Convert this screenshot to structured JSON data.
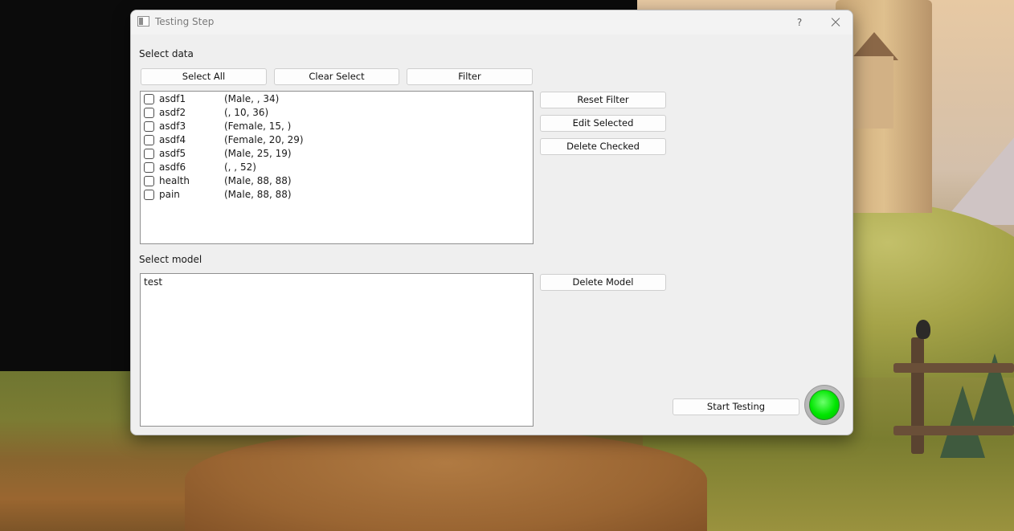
{
  "window": {
    "title": "Testing Step",
    "help_label": "?"
  },
  "data_section": {
    "label": "Select data",
    "buttons": {
      "select_all": "Select All",
      "clear_select": "Clear Select",
      "filter": "Filter",
      "reset_filter": "Reset Filter",
      "edit_selected": "Edit Selected",
      "delete_checked": "Delete Checked"
    },
    "items": [
      {
        "name": "asdf1",
        "info": "(Male, , 34)",
        "checked": false
      },
      {
        "name": "asdf2",
        "info": "(, 10, 36)",
        "checked": false
      },
      {
        "name": "asdf3",
        "info": "(Female, 15, )",
        "checked": false
      },
      {
        "name": "asdf4",
        "info": "(Female, 20, 29)",
        "checked": false
      },
      {
        "name": "asdf5",
        "info": "(Male, 25, 19)",
        "checked": false
      },
      {
        "name": "asdf6",
        "info": "(, , 52)",
        "checked": false
      },
      {
        "name": "health",
        "info": "(Male, 88, 88)",
        "checked": false
      },
      {
        "name": "pain",
        "info": "(Male, 88, 88)",
        "checked": false
      }
    ]
  },
  "model_section": {
    "label": "Select model",
    "delete_model": "Delete Model",
    "models": [
      "test"
    ]
  },
  "testing": {
    "start_label": "Start Testing",
    "status_color": "#00e600"
  }
}
